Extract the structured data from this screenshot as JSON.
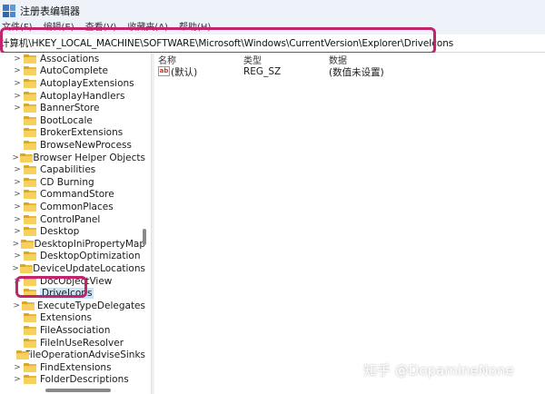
{
  "window": {
    "title": "注册表编辑器"
  },
  "menu": [
    "文件(F)",
    "编辑(E)",
    "查看(V)",
    "收藏夹(A)",
    "帮助(H)"
  ],
  "address": {
    "path": "计算机\\HKEY_LOCAL_MACHINE\\SOFTWARE\\Microsoft\\Windows\\CurrentVersion\\Explorer\\DriveIcons"
  },
  "tree": {
    "items": [
      {
        "label": "Associations",
        "chevron": ">"
      },
      {
        "label": "AutoComplete",
        "chevron": ">"
      },
      {
        "label": "AutoplayExtensions",
        "chevron": ">"
      },
      {
        "label": "AutoplayHandlers",
        "chevron": ">"
      },
      {
        "label": "BannerStore",
        "chevron": ">"
      },
      {
        "label": "BootLocale",
        "chevron": ""
      },
      {
        "label": "BrokerExtensions",
        "chevron": ""
      },
      {
        "label": "BrowseNewProcess",
        "chevron": ""
      },
      {
        "label": "Browser Helper Objects",
        "chevron": ">"
      },
      {
        "label": "Capabilities",
        "chevron": ">"
      },
      {
        "label": "CD Burning",
        "chevron": ">"
      },
      {
        "label": "CommandStore",
        "chevron": ">"
      },
      {
        "label": "CommonPlaces",
        "chevron": ">"
      },
      {
        "label": "ControlPanel",
        "chevron": ">"
      },
      {
        "label": "Desktop",
        "chevron": ">"
      },
      {
        "label": "DesktopIniPropertyMap",
        "chevron": ">"
      },
      {
        "label": "DesktopOptimization",
        "chevron": ">"
      },
      {
        "label": "DeviceUpdateLocations",
        "chevron": ">"
      },
      {
        "label": "DocObjectView",
        "chevron": ">"
      },
      {
        "label": "DriveIcons",
        "chevron": "",
        "selected": true
      },
      {
        "label": "ExecuteTypeDelegates",
        "chevron": ">"
      },
      {
        "label": "Extensions",
        "chevron": ""
      },
      {
        "label": "FileAssociation",
        "chevron": ""
      },
      {
        "label": "FileInUseResolver",
        "chevron": ""
      },
      {
        "label": "FileOperationAdviseSinks",
        "chevron": ""
      },
      {
        "label": "FindExtensions",
        "chevron": ">"
      },
      {
        "label": "FolderDescriptions",
        "chevron": ">"
      }
    ]
  },
  "details": {
    "columns": {
      "name": "名称",
      "type": "类型",
      "data": "数据"
    },
    "rows": [
      {
        "icon": "ab",
        "name": "(默认)",
        "type": "REG_SZ",
        "data": "(数值未设置)"
      }
    ]
  },
  "watermark": "知乎 @DopamineNone",
  "colors": {
    "highlight": "#c3246e",
    "selection": "#cce4f7",
    "folder": "#f6d15e"
  }
}
